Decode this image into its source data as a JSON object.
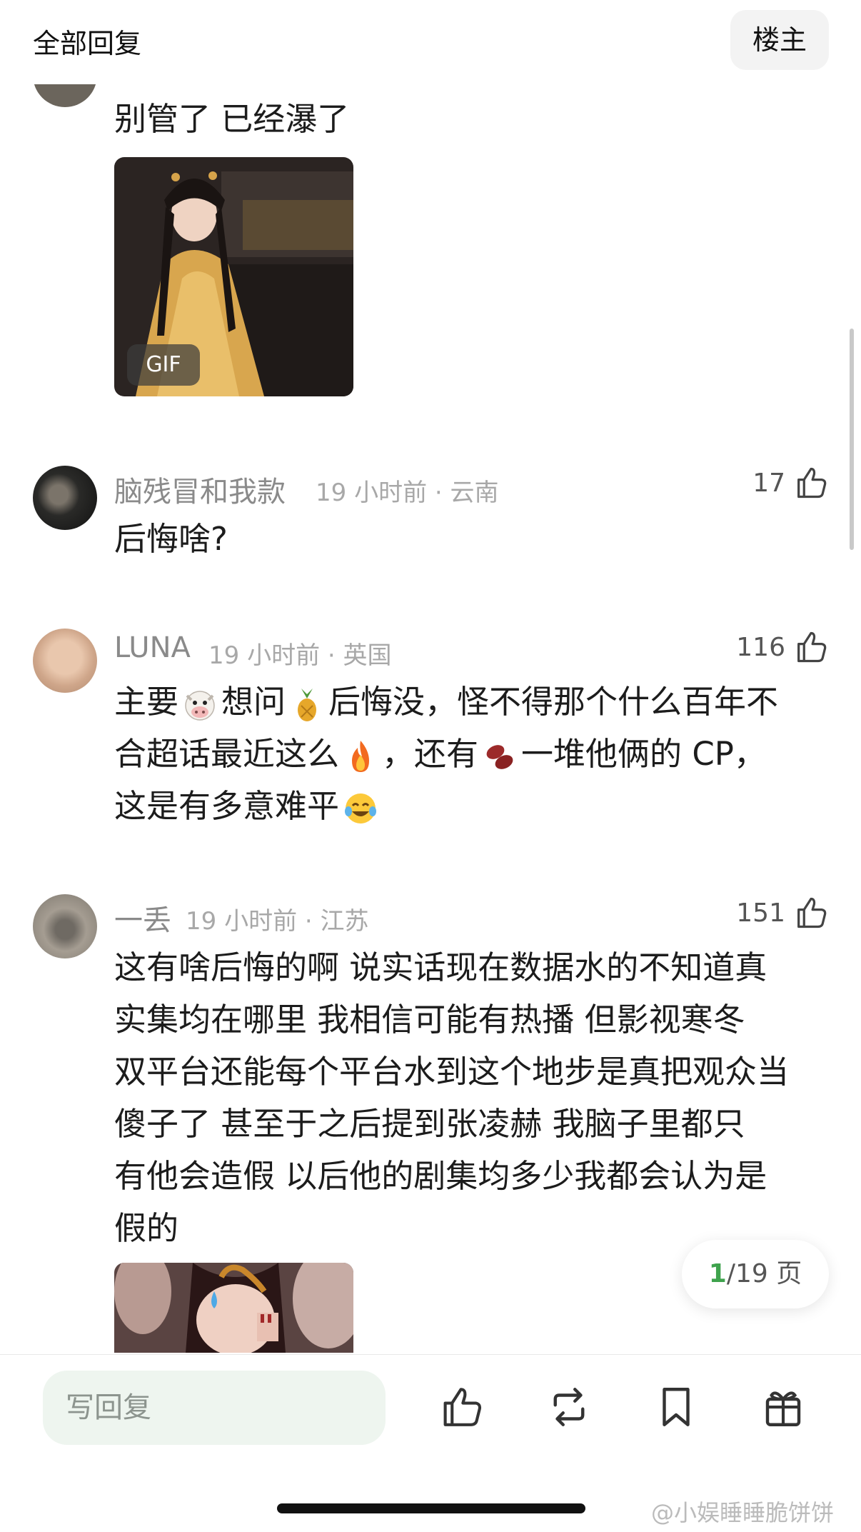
{
  "header": {
    "title": "全部回复",
    "op_button": "楼主"
  },
  "comments": [
    {
      "text": "别管了 已经瀑了",
      "media_badge": "GIF"
    },
    {
      "user": "脑残冒和我款",
      "meta": "19 小时前 · 云南",
      "likes": "17",
      "text": "后悔啥?"
    },
    {
      "user": "LUNA",
      "meta": "19 小时前 · 英国",
      "likes": "116",
      "line1_a": "主要",
      "line1_b": "想问",
      "line1_c": "后悔没，怪不得那个什么百年不",
      "line2_a": "合超话最近这么",
      "line2_b": "，还有",
      "line2_c": "一堆他俩的 CP，",
      "line3_a": "这是有多意难平"
    },
    {
      "user": "一丢",
      "meta": "19 小时前 · 江苏",
      "likes": "151",
      "lines": [
        "这有啥后悔的啊  说实话现在数据水的不知道真",
        "实集均在哪里  我相信可能有热播  但影视寒冬",
        "双平台还能每个平台水到这个地步是真把观众当",
        "傻子了   甚至于之后提到张凌赫  我脑子里都只",
        "有他会造假   以后他的剧集均多少我都会认为是",
        "假的"
      ]
    }
  ],
  "pager": {
    "current": "1",
    "total": "/19 页"
  },
  "bottom": {
    "reply_placeholder": "写回复"
  },
  "watermark": "@小娱睡睡脆饼饼",
  "colors": {
    "accent_green": "#3fa34d",
    "input_bg": "#eef5ef"
  },
  "icons": [
    "thumb-up-icon",
    "repost-icon",
    "bookmark-icon",
    "gift-icon"
  ]
}
